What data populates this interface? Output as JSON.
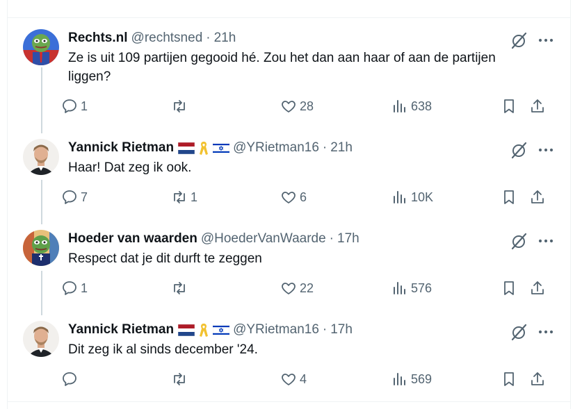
{
  "tweets": [
    {
      "name": "Rechts.nl",
      "handle": "@rechtsned",
      "dot": "·",
      "time": "21h",
      "text": "Ze is uit 109 partijen gegooid hé. Zou het dan aan haar of aan de partijen liggen?",
      "replies": "1",
      "retweets": "",
      "likes": "28",
      "views": "638",
      "flags": false
    },
    {
      "name": "Yannick Rietman",
      "handle": "@YRietman16",
      "dot": "·",
      "time": "21h",
      "text": "Haar! Dat zeg ik ook.",
      "replies": "7",
      "retweets": "1",
      "likes": "6",
      "views": "10K",
      "flags": true
    },
    {
      "name": "Hoeder van waarden",
      "handle": "@HoederVanWaarde",
      "dot": "·",
      "time": "17h",
      "text": "Respect dat je dit durft te zeggen",
      "replies": "1",
      "retweets": "",
      "likes": "22",
      "views": "576",
      "flags": false
    },
    {
      "name": "Yannick Rietman",
      "handle": "@YRietman16",
      "dot": "·",
      "time": "17h",
      "text": "Dit zeg ik al sinds december '24.",
      "replies": "",
      "retweets": "",
      "likes": "4",
      "views": "569",
      "flags": true
    }
  ],
  "icons": {
    "reply": "reply-icon",
    "retweet": "retweet-icon",
    "like": "heart-icon",
    "views": "views-icon",
    "bookmark": "bookmark-icon",
    "share": "share-icon",
    "grok": "grok-icon",
    "more": "more-icon"
  },
  "colors": {
    "text": "#0f1419",
    "secondary": "#536471",
    "border": "#eff3f4",
    "thread_line": "#cfd9de"
  }
}
